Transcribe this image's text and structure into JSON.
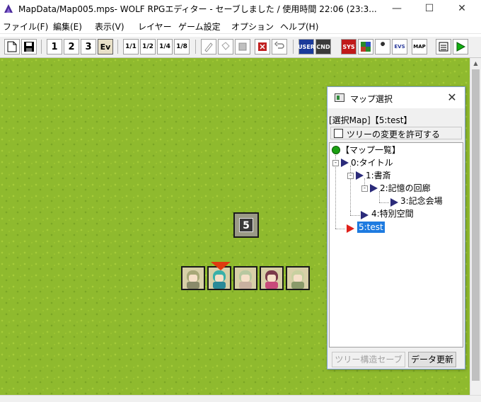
{
  "window": {
    "title": "MapData/Map005.mps- WOLF RPGエディター - セーブしました / 使用時間 22:06 (23:3...",
    "minimize_glyph": "—",
    "maximize_glyph": "☐",
    "close_glyph": "✕"
  },
  "menu": {
    "items": [
      "ファイル(F)",
      "編集(E)",
      "表示(V)",
      "レイヤー",
      "ゲーム設定",
      "オプション",
      "ヘルプ(H)"
    ]
  },
  "toolbar": {
    "layer1": "1",
    "layer2": "2",
    "layer3": "3",
    "event_mode": "Ev",
    "tile_label_1": "1/1",
    "tile_label_2": "1/2",
    "tile_label_3": "1/4",
    "tile_label_4": "1/8",
    "db_user": "USER",
    "db_cnd": "CND",
    "db_sys": "SYS",
    "map_label": "MAP",
    "evs_label": "EVS"
  },
  "map": {
    "event_number": "5"
  },
  "map_select": {
    "title": "マップ選択",
    "close": "✕",
    "selection_info": "[選択Map]【5:test】",
    "allow_tree_change_label": "ツリーの変更を許可する",
    "allow_tree_change_checked": false,
    "tree": {
      "root": "【マップ一覧】",
      "nodes": [
        {
          "label": "0:タイトル"
        },
        {
          "label": "1:書斎"
        },
        {
          "label": "2:記憶の回廊"
        },
        {
          "label": "3:記念会場"
        },
        {
          "label": "4:特別空間"
        },
        {
          "label": "5:test",
          "selected": true
        }
      ]
    },
    "save_tree_button": "ツリー構造セーブ",
    "update_data_button": "データ更新"
  },
  "colors": {
    "grass": "#8fba2e",
    "selection": "#1e7be0",
    "tree_triangle": "#2b2b7a",
    "selected_triangle": "#e0201a",
    "root_dot": "#1aa012"
  }
}
